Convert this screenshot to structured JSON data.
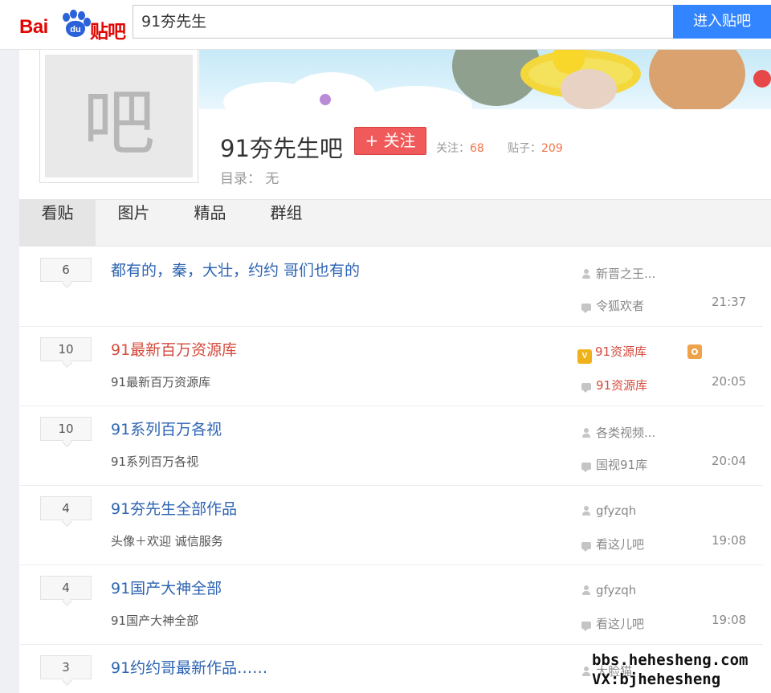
{
  "search": {
    "logo_text": "Bai",
    "logo_du": "du",
    "logo_tieba": "贴吧",
    "query": "91夯先生",
    "enter_label": "进入贴吧"
  },
  "forum": {
    "avatar_char": "吧",
    "name": "91夯先生吧",
    "follow_label": "+ 关注",
    "follow_stat_label": "关注：",
    "follow_count": "68",
    "post_stat_label": "贴子：",
    "post_count": "209",
    "catalog": "目录： 无"
  },
  "tabs": [
    "看贴",
    "图片",
    "精品",
    "群组"
  ],
  "threads": [
    {
      "replies": "6",
      "title": "都有的，秦，大壮，约约 哥们也有的",
      "abstract": "",
      "author": "新晋之王...",
      "last_reply": "令狐欢者",
      "time": "21:37"
    },
    {
      "replies": "10",
      "title": "91最新百万资源库",
      "abstract": "91最新百万资源库",
      "author": "91资源库",
      "last_reply": "91资源库",
      "time": "20:05"
    },
    {
      "replies": "10",
      "title": "91系列百万各视",
      "abstract": "91系列百万各视",
      "author": "各类视频...",
      "last_reply": "国视91库",
      "time": "20:04"
    },
    {
      "replies": "4",
      "title": "91夯先生全部作品",
      "abstract": "头像＋欢迎 诚信服务",
      "author": "gfyzqh",
      "last_reply": "看这儿吧",
      "time": "19:08"
    },
    {
      "replies": "4",
      "title": "91国产大神全部",
      "abstract": "91国产大神全部",
      "author": "gfyzqh",
      "last_reply": "看这儿吧",
      "time": "19:08"
    },
    {
      "replies": "3",
      "title": "91约约哥最新作品……",
      "abstract": "",
      "author": "大脸猫",
      "last_reply": "",
      "time": ""
    }
  ],
  "watermark": {
    "line1": "bbs.hehesheng.com",
    "line2": "VX:bjhehesheng"
  },
  "colors": {
    "accent_blue": "#3385ff",
    "follow_red": "#f05a5a",
    "title_blue": "#2d64b3",
    "title_red": "#d44c3f",
    "stat_orange": "#f2754a"
  }
}
